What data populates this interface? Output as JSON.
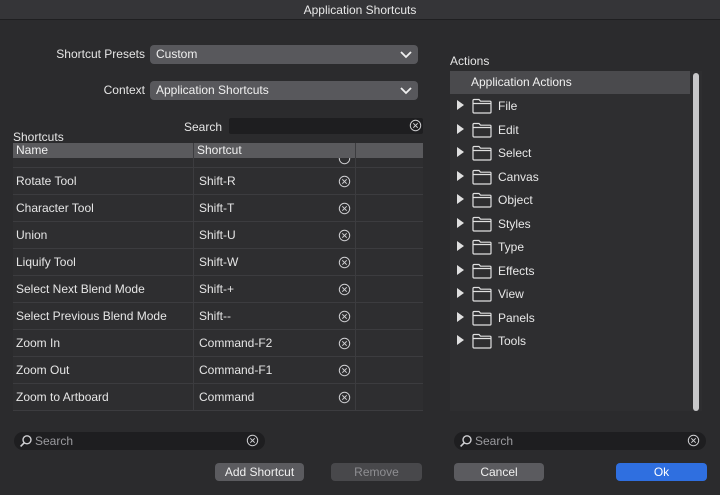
{
  "window": {
    "title": "Application Shortcuts"
  },
  "presets": {
    "label": "Shortcut Presets",
    "value": "Custom"
  },
  "context": {
    "label": "Context",
    "value": "Application Shortcuts"
  },
  "search_top": {
    "label": "Search"
  },
  "shortcuts": {
    "section_label": "Shortcuts",
    "columns": [
      "Name",
      "Shortcut"
    ],
    "rows": [
      {
        "name": "Rotate Tool",
        "shortcut": "Shift-R"
      },
      {
        "name": "Character Tool",
        "shortcut": "Shift-T"
      },
      {
        "name": "Union",
        "shortcut": "Shift-U"
      },
      {
        "name": "Liquify Tool",
        "shortcut": "Shift-W"
      },
      {
        "name": "Select Next Blend Mode",
        "shortcut": "Shift-+"
      },
      {
        "name": "Select Previous Blend Mode",
        "shortcut": "Shift--"
      },
      {
        "name": "Zoom In",
        "shortcut": "Command-F2"
      },
      {
        "name": "Zoom Out",
        "shortcut": "Command-F1"
      },
      {
        "name": "Zoom to Artboard",
        "shortcut": "Command"
      }
    ]
  },
  "left_search": {
    "placeholder": "Search"
  },
  "right_search": {
    "placeholder": "Search"
  },
  "buttons": {
    "add_shortcut": "Add Shortcut",
    "remove": "Remove",
    "cancel": "Cancel",
    "ok": "Ok"
  },
  "actions": {
    "label": "Actions",
    "root": "Application Actions",
    "items": [
      "File",
      "Edit",
      "Select",
      "Canvas",
      "Object",
      "Styles",
      "Type",
      "Effects",
      "View",
      "Panels",
      "Tools"
    ]
  },
  "colors": {
    "accent": "#2f6fe0",
    "background": "#2b2b2d"
  }
}
